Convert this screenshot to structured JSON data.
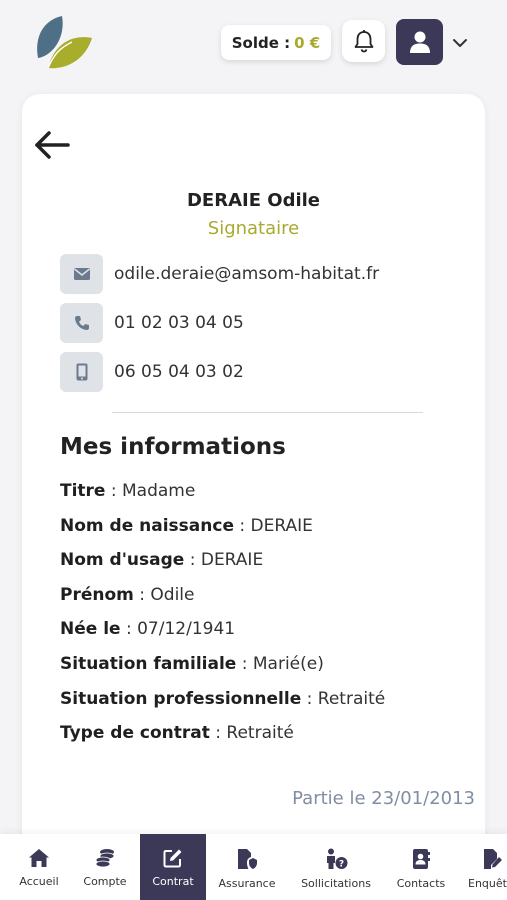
{
  "header": {
    "solde_label": "Solde :",
    "solde_amount": "0 €",
    "colors": {
      "accent": "#a9a930",
      "dark": "#3b3957"
    }
  },
  "profile": {
    "name": "DERAIE Odile",
    "role": "Signataire",
    "email": "odile.deraie@amsom-habitat.fr",
    "phone": "01 02 03 04 05",
    "mobile": "06 05 04 03 02"
  },
  "info": {
    "title": "Mes informations",
    "rows": [
      {
        "label": "Titre",
        "value": " : Madame"
      },
      {
        "label": "Nom de naissance",
        "value": " : DERAIE"
      },
      {
        "label": "Nom d'usage",
        "value": " : DERAIE"
      },
      {
        "label": "Prénom",
        "value": " : Odile"
      },
      {
        "label": "Née le",
        "value": " : 07/12/1941"
      },
      {
        "label": "Situation familiale",
        "value": " : Marié(e)"
      },
      {
        "label": "Situation professionnelle",
        "value": " : Retraité"
      },
      {
        "label": "Type de contrat",
        "value": " : Retraité"
      }
    ],
    "since": "Partie le 23/01/2013"
  },
  "nav": {
    "items": [
      {
        "label": "Accueil",
        "icon": "home-icon"
      },
      {
        "label": "Compte",
        "icon": "coins-icon"
      },
      {
        "label": "Contrat",
        "icon": "edit-icon",
        "active": true
      },
      {
        "label": "Assurance",
        "icon": "file-shield-icon"
      },
      {
        "label": "Sollicitations",
        "icon": "person-question-icon"
      },
      {
        "label": "Contacts",
        "icon": "address-book-icon"
      },
      {
        "label": "Enquêtes",
        "icon": "file-pen-icon"
      }
    ]
  }
}
